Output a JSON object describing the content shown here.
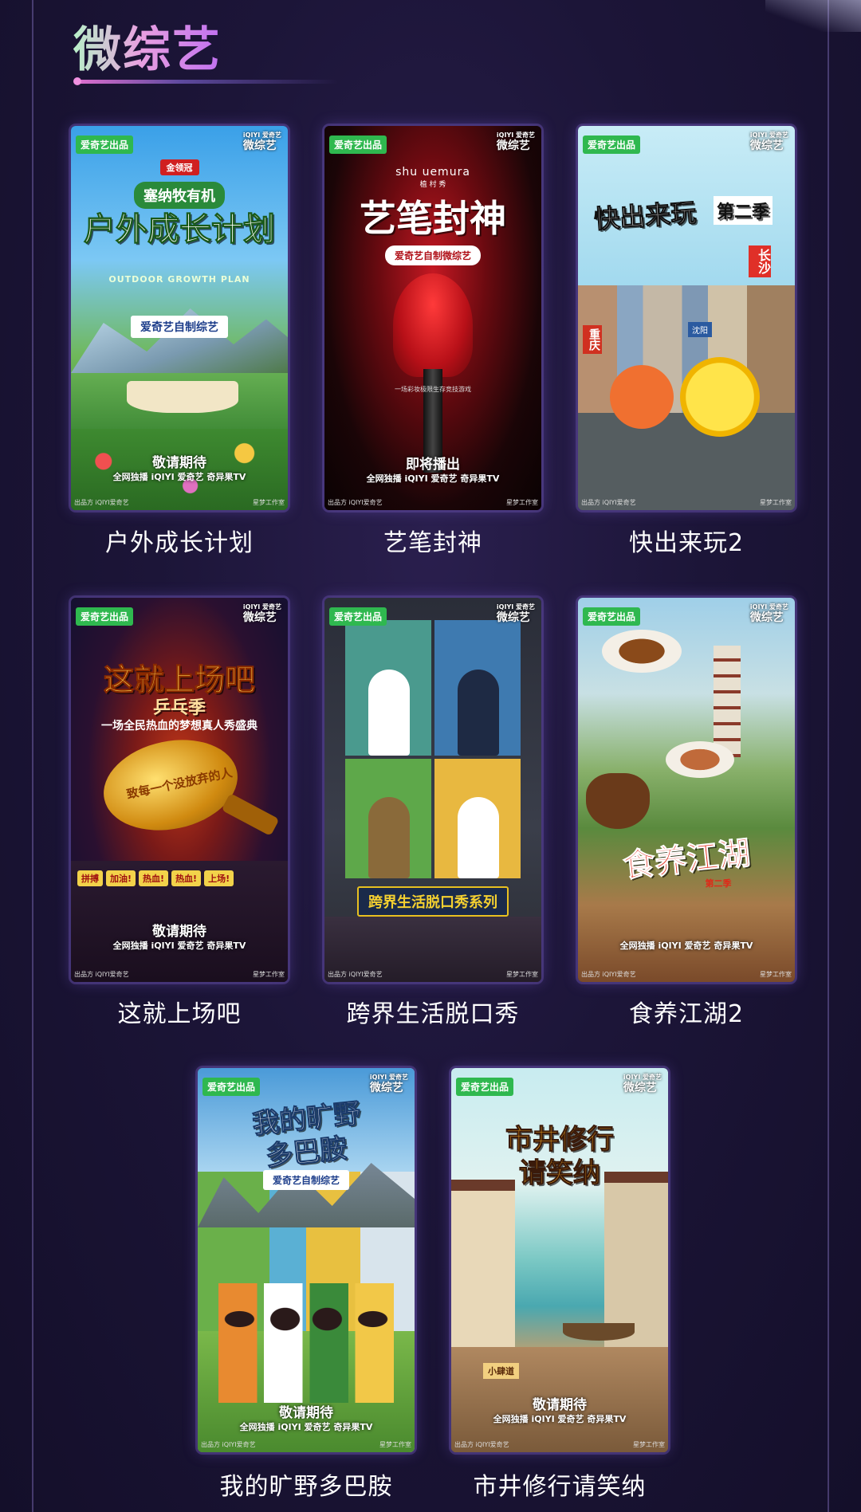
{
  "section": {
    "title": "微综艺"
  },
  "common": {
    "badge_left": "爱奇艺出品",
    "badge_right_top": "iQIYI 爱奇艺",
    "badge_right": "微综艺",
    "brand": "全网独播 iQIYI 爱奇艺 奇异果TV",
    "footer_left": "出品方 iQIYI爱奇艺",
    "footer_right": "星梦工作室"
  },
  "cards": [
    {
      "label": "户外成长计划",
      "sponsor": "金领冠",
      "pre_title": "塞纳牧有机",
      "title": "户外成长计划",
      "subtitle": "OUTDOOR GROWTH PLAN",
      "tag": "爱奇艺自制综艺",
      "release": "敬请期待"
    },
    {
      "label": "艺笔封神",
      "brand_top": "shu uemura",
      "brand_cn": "植 村 秀",
      "title": "艺笔封神",
      "tag": "爱奇艺自制微综艺",
      "desc": "一场彩妆极限生存竞技游戏",
      "release": "即将播出"
    },
    {
      "label": "快出来玩2",
      "title": "快出来玩",
      "season": "第二季",
      "city1": "长沙",
      "city2": "重庆",
      "city3": "沈阳"
    },
    {
      "label": "这就上场吧",
      "title": "这就上场吧",
      "subtitle": "乒乓季",
      "tag": "一场全民热血的梦想真人秀盛典",
      "slogan": "致每一个没放弃的人",
      "chips": [
        "拼搏",
        "加油!",
        "热血!",
        "热血!",
        "上场!"
      ],
      "release": "敬请期待"
    },
    {
      "label": "跨界生活脱口秀",
      "title": "跨界生活脱口秀系列"
    },
    {
      "label": "食养江湖2",
      "title": "食养江湖",
      "season": "第二季"
    },
    {
      "label": "我的旷野多巴胺",
      "title_line1": "我的旷野",
      "title_line2": "多巴胺",
      "tag": "爱奇艺自制综艺",
      "release": "敬请期待"
    },
    {
      "label": "市井修行请笑纳",
      "title_line1": "市井修行",
      "title_line2": "请笑纳",
      "shop": "小肆道",
      "release": "敬请期待"
    }
  ],
  "colors": {
    "accent_green": "#2fb84f",
    "bg_dark": "#1c1538",
    "title_pink": "#e8a0e0"
  }
}
